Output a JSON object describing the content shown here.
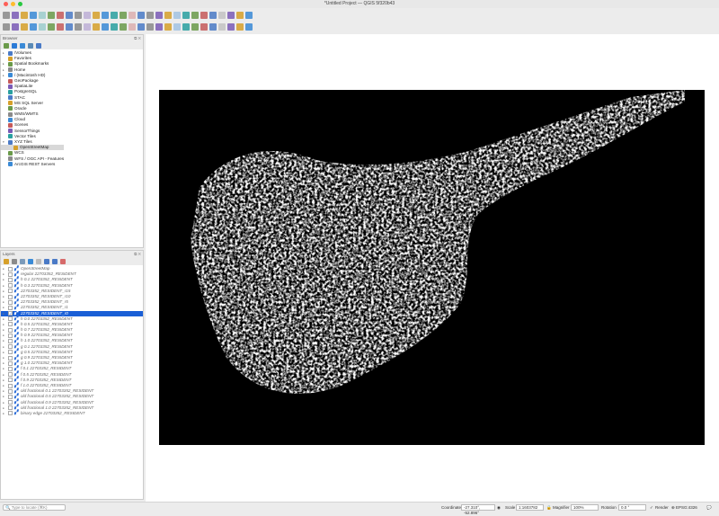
{
  "window": {
    "title": "*Untitled Project — QGIS 5f320b43"
  },
  "colors": {
    "accent": "#1a5fd6",
    "map_background": "#000000",
    "map_foreground": "#ffffff"
  },
  "toolbar1": [
    "new-project",
    "open-project",
    "save-project",
    "save-as",
    "print-layout",
    "style-manager",
    "pan",
    "pan-to-selection",
    "zoom-in",
    "zoom-out",
    "zoom-full",
    "zoom-to-selection",
    "zoom-to-layer",
    "zoom-native",
    "zoom-last",
    "zoom-next",
    "new-map-view",
    "temporal",
    "refresh",
    "select",
    "deselect",
    "identify-features",
    "open-attribute-table",
    "statistics",
    "sum",
    "measure",
    "map-tips",
    "annotations"
  ],
  "toolbar2": [
    "data-source-manager",
    "new-geopackage-layer",
    "new-shapefile",
    "new-spatialite",
    "new-virtual-layer",
    "add-raster",
    "add-vector",
    "current-edits",
    "toggle-editing",
    "save-edits",
    "digitize",
    "move-feature",
    "vertex-tool",
    "delete-selected",
    "cut",
    "copy",
    "paste",
    "undo",
    "redo",
    "label",
    "pin-labels",
    "show-labels",
    "move-label",
    "rotate-label",
    "change-label",
    "plugins-python",
    "python-console",
    "help"
  ],
  "browser": {
    "title": "Browser",
    "items": [
      {
        "label": "/Volumes",
        "expandable": true,
        "icon": "folder"
      },
      {
        "label": "Favorites",
        "expandable": false,
        "icon": "star"
      },
      {
        "label": "Spatial Bookmarks",
        "expandable": true,
        "icon": "bookmark"
      },
      {
        "label": "Home",
        "expandable": true,
        "icon": "home"
      },
      {
        "label": "/ (Macintosh HD)",
        "expandable": true,
        "icon": "folder"
      },
      {
        "label": "GeoPackage",
        "expandable": false,
        "icon": "geopackage"
      },
      {
        "label": "SpatiaLite",
        "expandable": false,
        "icon": "spatialite"
      },
      {
        "label": "PostgreSQL",
        "expandable": false,
        "icon": "postgresql"
      },
      {
        "label": "STAC",
        "expandable": false,
        "icon": "stac"
      },
      {
        "label": "MS SQL Server",
        "expandable": false,
        "icon": "mssql"
      },
      {
        "label": "Oracle",
        "expandable": false,
        "icon": "oracle"
      },
      {
        "label": "WMS/WMTS",
        "expandable": false,
        "icon": "wms"
      },
      {
        "label": "Cloud",
        "expandable": false,
        "icon": "cloud"
      },
      {
        "label": "Scenes",
        "expandable": false,
        "icon": "scenes"
      },
      {
        "label": "SensorThings",
        "expandable": false,
        "icon": "sensor"
      },
      {
        "label": "Vector Tiles",
        "expandable": false,
        "icon": "vector-tiles"
      },
      {
        "label": "XYZ Tiles",
        "expandable": true,
        "expanded": true,
        "icon": "xyz"
      },
      {
        "label": "OpenStreetMap",
        "child": true,
        "selected": true,
        "icon": "tiles"
      },
      {
        "label": "WCS",
        "expandable": false,
        "icon": "wcs"
      },
      {
        "label": "WFS / OGC API - Features",
        "expandable": false,
        "icon": "wfs"
      },
      {
        "label": "ArcGIS REST Servers",
        "expandable": false,
        "icon": "arcgis"
      }
    ]
  },
  "layers": {
    "title": "Layers",
    "items": [
      {
        "label": "OpenStreetMap",
        "checked": false
      },
      {
        "label": "regular 22703352_RESIDENT",
        "checked": false
      },
      {
        "label": "h 0.1 22703352_RESIDENT",
        "checked": false
      },
      {
        "label": "h 0.3 22703352_RESIDENT",
        "checked": false
      },
      {
        "label": "22703352_RESIDENT_r15",
        "checked": false
      },
      {
        "label": "22703352_RESIDENT_r10",
        "checked": false
      },
      {
        "label": "22703352_RESIDENT_r5",
        "checked": false
      },
      {
        "label": "22703352_RESIDENT_r1",
        "checked": false
      },
      {
        "label": "22703352_RESIDENT_r0",
        "checked": true,
        "selected": true
      },
      {
        "label": "h 0.0 22703352_RESIDENT",
        "checked": false
      },
      {
        "label": "h 0.5 22703352_RESIDENT",
        "checked": false
      },
      {
        "label": "h 0.7 22703352_RESIDENT",
        "checked": false
      },
      {
        "label": "h 0.9 22703352_RESIDENT",
        "checked": false
      },
      {
        "label": "h 1.0 22703352_RESIDENT",
        "checked": false
      },
      {
        "label": "g 0.1 22703352_RESIDENT",
        "checked": false
      },
      {
        "label": "g 0.5 22703352_RESIDENT",
        "checked": false
      },
      {
        "label": "g 0.9 22703352_RESIDENT",
        "checked": false
      },
      {
        "label": "g 1.0 22703352_RESIDENT",
        "checked": false
      },
      {
        "label": "f 0.1 22703352_RESIDENT",
        "checked": false
      },
      {
        "label": "f 0.5 22703352_RESIDENT",
        "checked": false
      },
      {
        "label": "f 0.9 22703352_RESIDENT",
        "checked": false
      },
      {
        "label": "f 1.0 22703352_RESIDENT",
        "checked": false
      },
      {
        "label": "old fractional 0.1 22703352_RESIDENT",
        "checked": false
      },
      {
        "label": "old fractional 0.5 22703352_RESIDENT",
        "checked": false
      },
      {
        "label": "old fractional 0.9 22703352_RESIDENT",
        "checked": false
      },
      {
        "label": "old fractional 1.0 22703352_RESIDENT",
        "checked": false
      },
      {
        "label": "binary edge 22703352_RESIDENT",
        "checked": false
      }
    ]
  },
  "status": {
    "search_placeholder": "Type to locate (⌘K)",
    "coordinate_label": "Coordinate",
    "coordinate_value": "-27.310°, -52.896°",
    "scale_label": "Scale",
    "scale_value": "1:1603782",
    "magnifier_label": "Magnifier",
    "magnifier_value": "100%",
    "rotation_label": "Rotation",
    "rotation_value": "0.0 °",
    "render_label": "Render",
    "render_checked": true,
    "crs": "EPSG:4326"
  }
}
